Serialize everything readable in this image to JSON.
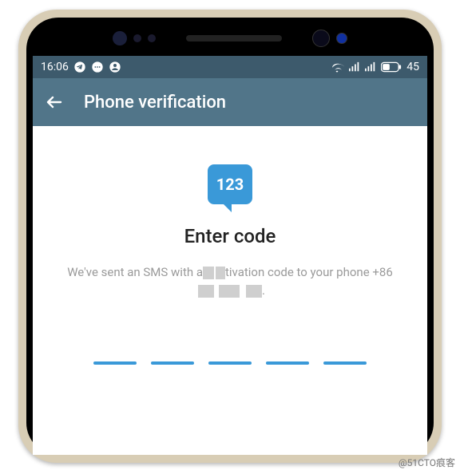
{
  "status": {
    "time": "16:06",
    "battery": "45"
  },
  "appbar": {
    "title": "Phone verification"
  },
  "main": {
    "icon_text": "123",
    "heading": "Enter code",
    "desc_pre": "We've sent an SMS with a",
    "desc_mid": "tivation code to your phone +8",
    "desc_post": "."
  },
  "watermark": "@51CTO痕客"
}
